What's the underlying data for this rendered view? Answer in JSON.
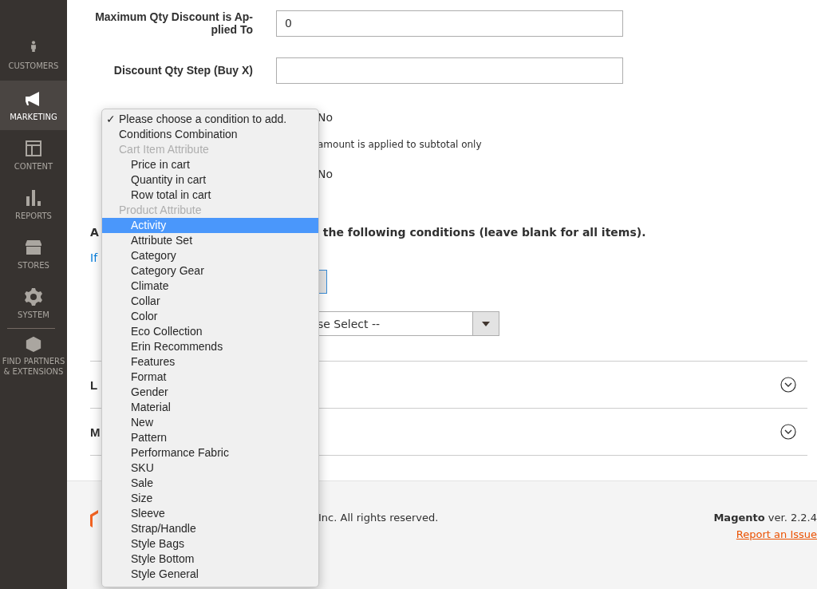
{
  "sidebar": {
    "items": [
      {
        "label": "CUSTOMERS",
        "selected": false
      },
      {
        "label": "MARKETING",
        "selected": true
      },
      {
        "label": "CONTENT",
        "selected": false
      },
      {
        "label": "REPORTS",
        "selected": false
      },
      {
        "label": "STORES",
        "selected": false
      },
      {
        "label": "SYSTEM",
        "selected": false
      },
      {
        "label": "FIND PARTNERS & EXTENSIONS",
        "selected": false
      }
    ]
  },
  "form": {
    "fields": [
      {
        "label": "Maximum Qty Discount is Ap-plied To",
        "value": "0"
      },
      {
        "label": "Discount Qty Step (Buy X)"
      }
    ],
    "partial_texts": [
      {
        "kind": "value",
        "text": "No"
      },
      {
        "kind": "note",
        "text": "amount is applied to subtotal only"
      },
      {
        "kind": "value",
        "text": "No"
      }
    ],
    "conditions_heading": {
      "start": "A",
      "end": "the following conditions (leave blank for all items)."
    },
    "conditions_link": "If",
    "select_value": "se Select --",
    "sections": [
      {
        "title": "L",
        "expanded": false
      },
      {
        "title": "M",
        "expanded": false
      }
    ]
  },
  "dropdown": {
    "check_mark": "✓",
    "items": [
      {
        "kind": "option",
        "label": "Please choose a condition to add.",
        "checked": true,
        "selected": false
      },
      {
        "kind": "option",
        "label": "Conditions Combination",
        "checked": false,
        "selected": false
      },
      {
        "kind": "group",
        "label": "Cart Item Attribute",
        "children": [
          {
            "kind": "option",
            "label": "Price in cart",
            "checked": false,
            "selected": false
          },
          {
            "kind": "option",
            "label": "Quantity in cart",
            "checked": false,
            "selected": false
          },
          {
            "kind": "option",
            "label": "Row total in cart",
            "checked": false,
            "selected": false
          }
        ]
      },
      {
        "kind": "group",
        "label": "Product Attribute",
        "children": [
          {
            "kind": "option",
            "label": "Activity",
            "checked": false,
            "selected": true
          },
          {
            "kind": "option",
            "label": "Attribute Set",
            "checked": false,
            "selected": false
          },
          {
            "kind": "option",
            "label": "Category",
            "checked": false,
            "selected": false
          },
          {
            "kind": "option",
            "label": "Category Gear",
            "checked": false,
            "selected": false
          },
          {
            "kind": "option",
            "label": "Climate",
            "checked": false,
            "selected": false
          },
          {
            "kind": "option",
            "label": "Collar",
            "checked": false,
            "selected": false
          },
          {
            "kind": "option",
            "label": "Color",
            "checked": false,
            "selected": false
          },
          {
            "kind": "option",
            "label": "Eco Collection",
            "checked": false,
            "selected": false
          },
          {
            "kind": "option",
            "label": "Erin Recommends",
            "checked": false,
            "selected": false
          },
          {
            "kind": "option",
            "label": "Features",
            "checked": false,
            "selected": false
          },
          {
            "kind": "option",
            "label": "Format",
            "checked": false,
            "selected": false
          },
          {
            "kind": "option",
            "label": "Gender",
            "checked": false,
            "selected": false
          },
          {
            "kind": "option",
            "label": "Material",
            "checked": false,
            "selected": false
          },
          {
            "kind": "option",
            "label": "New",
            "checked": false,
            "selected": false
          },
          {
            "kind": "option",
            "label": "Pattern",
            "checked": false,
            "selected": false
          },
          {
            "kind": "option",
            "label": "Performance Fabric",
            "checked": false,
            "selected": false
          },
          {
            "kind": "option",
            "label": "SKU",
            "checked": false,
            "selected": false
          },
          {
            "kind": "option",
            "label": "Sale",
            "checked": false,
            "selected": false
          },
          {
            "kind": "option",
            "label": "Size",
            "checked": false,
            "selected": false
          },
          {
            "kind": "option",
            "label": "Sleeve",
            "checked": false,
            "selected": false
          },
          {
            "kind": "option",
            "label": "Strap/Handle",
            "checked": false,
            "selected": false
          },
          {
            "kind": "option",
            "label": "Style Bags",
            "checked": false,
            "selected": false
          },
          {
            "kind": "option",
            "label": "Style Bottom",
            "checked": false,
            "selected": false
          },
          {
            "kind": "option",
            "label": "Style General",
            "checked": false,
            "selected": false
          }
        ]
      }
    ]
  },
  "footer": {
    "copyright": "Inc. All rights reserved.",
    "brand": "Magento",
    "version": "ver. 2.2.4",
    "link": "Report an Issue"
  }
}
